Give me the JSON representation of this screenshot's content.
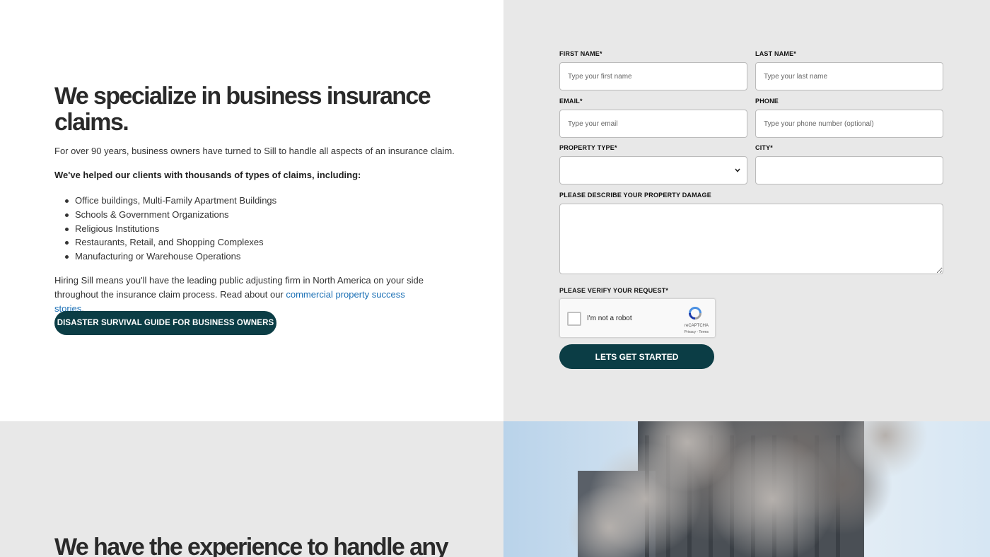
{
  "intro_section": {
    "heading": "We specialize in business insurance claims.",
    "intro_text": "For over 90 years, business owners have turned to Sill to handle all aspects of an insurance claim.",
    "helped_text": "We've helped our clients with thousands of types of claims, including:",
    "claim_types": [
      "Office buildings, Multi-Family Apartment Buildings",
      "Schools & Government Organizations",
      "Religious Institutions",
      "Restaurants, Retail, and Shopping Complexes",
      "Manufacturing or Warehouse Operations"
    ],
    "hiring_text": "Hiring Sill means you'll have the leading public adjusting firm in North America on your side throughout the insurance claim process. Read about our ",
    "success_link": "commercial property success stories",
    "hiring_end": ".",
    "guide_button": "DISASTER SURVIVAL GUIDE FOR BUSINESS OWNERS"
  },
  "form": {
    "first_name_label": "FIRST NAME*",
    "first_name_placeholder": "Type your first name",
    "last_name_label": "LAST NAME*",
    "last_name_placeholder": "Type your last name",
    "email_label": "EMAIL*",
    "email_placeholder": "Type your email",
    "phone_label": "PHONE",
    "phone_placeholder": "Type your phone number (optional)",
    "property_type_label": "PROPERTY TYPE*",
    "city_label": "CITY*",
    "damage_label": "PLEASE DESCRIBE YOUR PROPERTY DAMAGE",
    "verify_label": "PLEASE VERIFY YOUR REQUEST*",
    "captcha_text": "I'm not a robot",
    "captcha_brand": "reCAPTCHA",
    "captcha_terms": "Privacy - Terms",
    "submit_button": "LETS GET STARTED"
  },
  "experience_section": {
    "heading": "We have the experience to handle any"
  },
  "colors": {
    "accent": "#0b3d45",
    "link": "#1a6fb5",
    "panel_gray": "#e8e8e8"
  }
}
